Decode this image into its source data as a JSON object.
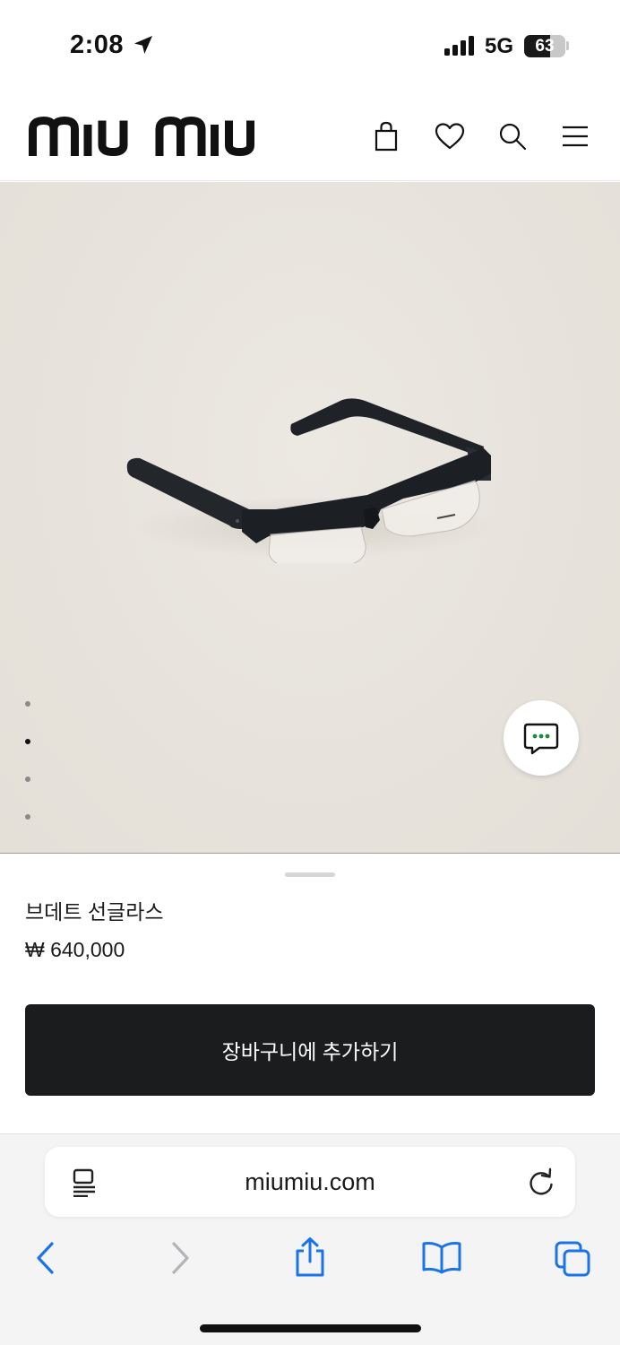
{
  "status_bar": {
    "time": "2:08",
    "network": "5G",
    "battery_level": "63",
    "battery_fraction": 0.63
  },
  "header": {
    "brand": "miu miu",
    "icons": [
      "shopping-bag-icon",
      "heart-icon",
      "search-icon",
      "menu-icon"
    ]
  },
  "gallery": {
    "image": "black-half-rim-glasses",
    "page_count": 4,
    "active_index": 1
  },
  "product": {
    "name": "브데트 선글라스",
    "price": "₩ 640,000",
    "add_to_cart_label": "장바구니에 추가하기"
  },
  "browser": {
    "url": "miumiu.com",
    "toolbar_icons": [
      "back-icon",
      "forward-icon",
      "share-icon",
      "bookmarks-icon",
      "tabs-icon"
    ]
  },
  "colors": {
    "background_image": "#e7e3dc",
    "button": "#1b1c1e",
    "safari_accent": "#1a73e8",
    "chat_dots": "#1e8e3e"
  }
}
